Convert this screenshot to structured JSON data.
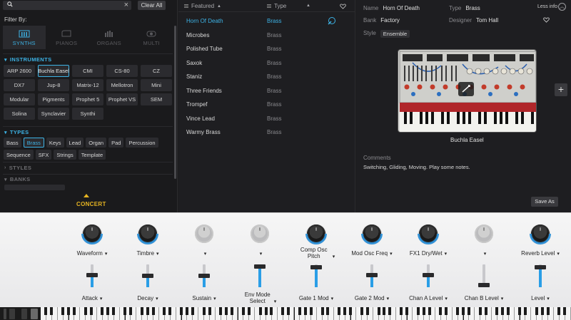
{
  "search": {
    "clear_label": "Clear All",
    "clear_icon": "×"
  },
  "filter_by_label": "Filter By:",
  "categories": [
    {
      "label": "SYNTHS",
      "active": true
    },
    {
      "label": "PIANOS",
      "active": false
    },
    {
      "label": "ORGANS",
      "active": false
    },
    {
      "label": "MULTI",
      "active": false
    }
  ],
  "sections": {
    "instruments": "INSTRUMENTS",
    "types": "TYPES",
    "styles": "STYLES",
    "banks": "BANKS"
  },
  "instruments": [
    "ARP 2600",
    "Buchla Easel",
    "CMI",
    "CS-80",
    "CZ",
    "DX7",
    "Jup-8",
    "Matrix-12",
    "Mellotron",
    "Mini",
    "Modular",
    "Pigments",
    "Prophet 5",
    "Prophet VS",
    "SEM",
    "Solina",
    "Synclavier",
    "Synthi"
  ],
  "instrument_selected": "Buchla Easel",
  "types": [
    "Bass",
    "Brass",
    "Keys",
    "Lead",
    "Organ",
    "Pad",
    "Percussion",
    "Sequence",
    "SFX",
    "Strings",
    "Template"
  ],
  "type_selected": "Brass",
  "concert_label": "CONCERT",
  "list": {
    "col_featured": "Featured",
    "col_type": "Type",
    "sort_arrow": "▲",
    "presets": [
      {
        "name": "Horn Of Death",
        "type": "Brass",
        "selected": true
      },
      {
        "name": "Microbes",
        "type": "Brass",
        "selected": false
      },
      {
        "name": "Polished Tube",
        "type": "Brass",
        "selected": false
      },
      {
        "name": "Saxok",
        "type": "Brass",
        "selected": false
      },
      {
        "name": "Staniz",
        "type": "Brass",
        "selected": false
      },
      {
        "name": "Three Friends",
        "type": "Brass",
        "selected": false
      },
      {
        "name": "Trompef",
        "type": "Brass",
        "selected": false
      },
      {
        "name": "Vince Lead",
        "type": "Brass",
        "selected": false
      },
      {
        "name": "Warmy Brass",
        "type": "Brass",
        "selected": false
      }
    ]
  },
  "info": {
    "name_label": "Name",
    "name_value": "Horn Of Death",
    "type_label": "Type",
    "type_value": "Brass",
    "bank_label": "Bank",
    "bank_value": "Factory",
    "designer_label": "Designer",
    "designer_value": "Tom Hall",
    "style_label": "Style",
    "style_value": "Ensemble",
    "less_info": "Less info",
    "instrument_name": "Buchla Easel",
    "comments_label": "Comments",
    "comments_text": "Switching, Gliding, Moving. Play some notes.",
    "save_as": "Save As",
    "add_icon": "+"
  },
  "knobs": [
    {
      "label": "Waveform",
      "active": true
    },
    {
      "label": "Timbre",
      "active": true
    },
    {
      "label": "",
      "active": false
    },
    {
      "label": "",
      "active": false
    },
    {
      "label": "Comp Osc Pitch",
      "active": true
    },
    {
      "label": "Mod Osc Freq",
      "active": true
    },
    {
      "label": "FX1 Dry/Wet",
      "active": true
    },
    {
      "label": "",
      "active": false
    },
    {
      "label": "Reverb Level",
      "active": true
    }
  ],
  "faders": [
    {
      "label": "Attack",
      "level": 0.55
    },
    {
      "label": "Decay",
      "level": 0.5
    },
    {
      "label": "Sustain",
      "level": 0.5
    },
    {
      "label": "Env Mode Select",
      "level": 1.0
    },
    {
      "label": "Gate 1 Mod",
      "level": 0.95
    },
    {
      "label": "Gate 2 Mod",
      "level": 0.55
    },
    {
      "label": "Chan A Level",
      "level": 0.55
    },
    {
      "label": "Chan B Level",
      "level": 0.0
    },
    {
      "label": "Level",
      "level": 0.95
    }
  ],
  "dropdown_arrow": "▾",
  "colors": {
    "accent": "#3db3e6",
    "concert": "#e6b422",
    "fader": "#2a9ee6"
  }
}
